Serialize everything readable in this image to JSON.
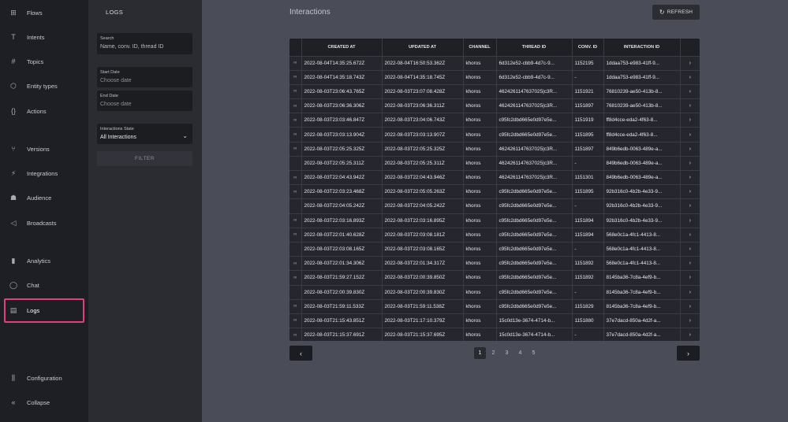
{
  "nav": {
    "items": [
      {
        "label": "Flows",
        "icon": "flows-icon",
        "glyph": "⊞"
      },
      {
        "label": "Intents",
        "icon": "intents-icon",
        "glyph": "T"
      },
      {
        "label": "Topics",
        "icon": "hash-icon",
        "glyph": "#"
      },
      {
        "label": "Entity types",
        "icon": "cube-icon",
        "glyph": "⬡"
      },
      {
        "label": "Actions",
        "icon": "braces-icon",
        "glyph": "{}"
      },
      {
        "label": "Versions",
        "icon": "branch-icon",
        "glyph": "⑂"
      },
      {
        "label": "Integrations",
        "icon": "plug-icon",
        "glyph": "⚡"
      },
      {
        "label": "Audience",
        "icon": "audience-icon",
        "glyph": "☗"
      },
      {
        "label": "Broadcasts",
        "icon": "megaphone-icon",
        "glyph": "◁"
      },
      {
        "label": "Analytics",
        "icon": "bar-chart-icon",
        "glyph": "▮"
      },
      {
        "label": "Chat",
        "icon": "chat-bubble-icon",
        "glyph": "◯"
      },
      {
        "label": "Logs",
        "icon": "document-icon",
        "glyph": "▤"
      },
      {
        "label": "Configuration",
        "icon": "sliders-icon",
        "glyph": "⫼"
      },
      {
        "label": "Collapse",
        "icon": "double-chevron-left-icon",
        "glyph": "«"
      }
    ]
  },
  "panel": {
    "title": "LOGS",
    "search": {
      "label": "Search",
      "placeholder": "Name, conv. ID, thread ID"
    },
    "start_date": {
      "label": "Start Date",
      "placeholder": "Choose date"
    },
    "end_date": {
      "label": "End Date",
      "placeholder": "Choose date"
    },
    "state": {
      "label": "Interactions State",
      "value": "All Interactions"
    },
    "filter_label": "FILTER"
  },
  "main": {
    "title": "Interactions",
    "refresh_label": "REFRESH"
  },
  "table": {
    "columns": [
      "",
      "CREATED AT",
      "UPDATED AT",
      "CHANNEL",
      "THREAD ID",
      "CONV. ID",
      "INTERACTION ID",
      ""
    ],
    "rows": [
      {
        "linked": true,
        "created": "2022-08-04T14:35:25.672Z",
        "updated": "2022-08-04T16:50:53.362Z",
        "channel": "khoros",
        "thread": "6d312e52-cbb9-4d7c-9...",
        "conv": "1152195",
        "interaction": "1ddaa753-e983-41ff-9..."
      },
      {
        "linked": true,
        "created": "2022-08-04T14:35:18.743Z",
        "updated": "2022-08-04T14:35:18.745Z",
        "channel": "khoros",
        "thread": "6d312e52-cbb9-4d7c-9...",
        "conv": "-",
        "interaction": "1ddaa753-e983-41ff-9..."
      },
      {
        "linked": true,
        "created": "2022-08-03T23:06:43.765Z",
        "updated": "2022-08-03T23:07:08.428Z",
        "channel": "khoros",
        "thread": "4624261147637025|c3R...",
        "conv": "1151921",
        "interaction": "76810239-ae50-413b-8..."
      },
      {
        "linked": true,
        "created": "2022-08-03T23:06:36.306Z",
        "updated": "2022-08-03T23:06:36.311Z",
        "channel": "khoros",
        "thread": "4624261147637025|c3R...",
        "conv": "1151897",
        "interaction": "76810239-ae50-413b-8..."
      },
      {
        "linked": true,
        "created": "2022-08-03T23:03:46.847Z",
        "updated": "2022-08-03T23:04:06.743Z",
        "channel": "khoros",
        "thread": "c95fc2dbd665e0d97e5e...",
        "conv": "1151919",
        "interaction": "ff8d4cce-eda2-4f63-8..."
      },
      {
        "linked": true,
        "created": "2022-08-03T23:03:13.904Z",
        "updated": "2022-08-03T23:03:13.907Z",
        "channel": "khoros",
        "thread": "c95fc2dbd665e0d97e5e...",
        "conv": "1151895",
        "interaction": "ff8d4cce-eda2-4f63-8..."
      },
      {
        "linked": true,
        "created": "2022-08-03T22:05:25.325Z",
        "updated": "2022-08-03T22:05:25.325Z",
        "channel": "khoros",
        "thread": "4624261147637025|c3R...",
        "conv": "1151897",
        "interaction": "849b6edb-0063-489e-a..."
      },
      {
        "linked": false,
        "created": "2022-08-03T22:05:25.311Z",
        "updated": "2022-08-03T22:05:25.311Z",
        "channel": "khoros",
        "thread": "4624261147637025|c3R...",
        "conv": "-",
        "interaction": "849b6edb-0063-489e-a..."
      },
      {
        "linked": true,
        "created": "2022-08-03T22:04:43.942Z",
        "updated": "2022-08-03T22:04:43.946Z",
        "channel": "khoros",
        "thread": "4624261147637025|c3R...",
        "conv": "1151301",
        "interaction": "849b6edb-0063-489e-a..."
      },
      {
        "linked": true,
        "created": "2022-08-03T22:03:23.468Z",
        "updated": "2022-08-03T22:05:05.263Z",
        "channel": "khoros",
        "thread": "c95fc2dbd665e0d97e5e...",
        "conv": "1151895",
        "interaction": "92b316c0-4b2b-4e33-9..."
      },
      {
        "linked": false,
        "created": "2022-08-03T22:04:05.242Z",
        "updated": "2022-08-03T22:04:05.242Z",
        "channel": "khoros",
        "thread": "c95fc2dbd665e0d97e5e...",
        "conv": "-",
        "interaction": "92b316c0-4b2b-4e33-9..."
      },
      {
        "linked": true,
        "created": "2022-08-03T22:03:16.893Z",
        "updated": "2022-08-03T22:03:16.895Z",
        "channel": "khoros",
        "thread": "c95fc2dbd665e0d97e5e...",
        "conv": "1151894",
        "interaction": "92b316c0-4b2b-4e33-9..."
      },
      {
        "linked": true,
        "created": "2022-08-03T22:01:40.628Z",
        "updated": "2022-08-03T22:03:08.181Z",
        "channel": "khoros",
        "thread": "c95fc2dbd665e0d97e5e...",
        "conv": "1151894",
        "interaction": "568e0c1a-4fc1-4413-8..."
      },
      {
        "linked": false,
        "created": "2022-08-03T22:03:08.165Z",
        "updated": "2022-08-03T22:03:08.165Z",
        "channel": "khoros",
        "thread": "c95fc2dbd665e0d97e5e...",
        "conv": "-",
        "interaction": "568e0c1a-4fc1-4413-8..."
      },
      {
        "linked": true,
        "created": "2022-08-03T22:01:34.306Z",
        "updated": "2022-08-03T22:01:34.317Z",
        "channel": "khoros",
        "thread": "c95fc2dbd665e0d97e5e...",
        "conv": "1151892",
        "interaction": "568e0c1a-4fc1-4413-8..."
      },
      {
        "linked": true,
        "created": "2022-08-03T21:59:27.152Z",
        "updated": "2022-08-03T22:00:39.850Z",
        "channel": "khoros",
        "thread": "c95fc2dbd665e0d97e5e...",
        "conv": "1151892",
        "interaction": "8145ba36-7c8a-4ef9-b..."
      },
      {
        "linked": false,
        "created": "2022-08-03T22:00:39.830Z",
        "updated": "2022-08-03T22:00:39.830Z",
        "channel": "khoros",
        "thread": "c95fc2dbd665e0d97e5e...",
        "conv": "-",
        "interaction": "8145ba36-7c8a-4ef9-b..."
      },
      {
        "linked": true,
        "created": "2022-08-03T21:59:11.533Z",
        "updated": "2022-08-03T21:59:11.538Z",
        "channel": "khoros",
        "thread": "c95fc2dbd665e0d97e5e...",
        "conv": "1151829",
        "interaction": "8145ba36-7c8a-4ef9-b..."
      },
      {
        "linked": true,
        "created": "2022-08-03T21:15:43.851Z",
        "updated": "2022-08-03T21:17:10.379Z",
        "channel": "khoros",
        "thread": "15c0d13e-3674-4714-b...",
        "conv": "1151880",
        "interaction": "37e7dacd-850a-4d2f-a..."
      },
      {
        "linked": true,
        "created": "2022-08-03T21:15:37.691Z",
        "updated": "2022-08-03T21:15:37.695Z",
        "channel": "khoros",
        "thread": "15c0d13e-3674-4714-b...",
        "conv": "-",
        "interaction": "37e7dacd-850a-4d2f-a..."
      }
    ]
  },
  "pagination": {
    "pages": [
      "1",
      "2",
      "3",
      "4",
      "5"
    ],
    "current": "1",
    "prev_glyph": "‹",
    "next_glyph": "›"
  },
  "colors": {
    "highlight": "#e0417e",
    "background": "#4a4c57",
    "nav": "#1e1f24"
  }
}
